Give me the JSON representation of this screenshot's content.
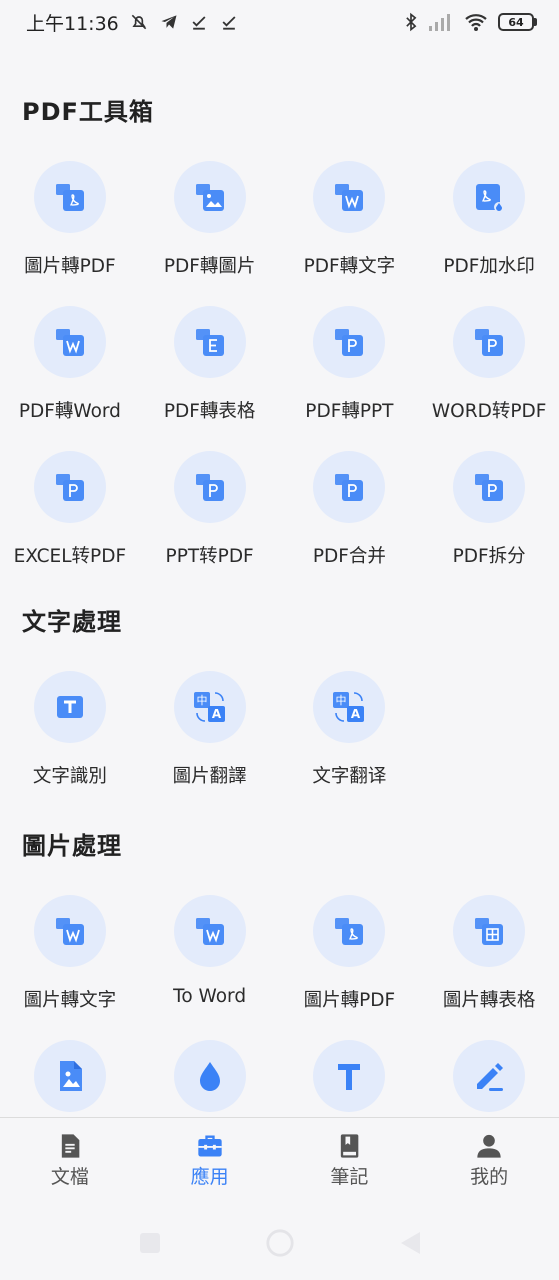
{
  "status_bar": {
    "time": "上午11:36",
    "battery": "64"
  },
  "sections": {
    "pdf": {
      "title": "PDF工具箱",
      "items": [
        {
          "label": "圖片轉PDF",
          "icon": "image-to-pdf-icon"
        },
        {
          "label": "PDF轉圖片",
          "icon": "pdf-to-image-icon"
        },
        {
          "label": "PDF轉文字",
          "icon": "pdf-to-text-icon"
        },
        {
          "label": "PDF加水印",
          "icon": "pdf-watermark-icon"
        },
        {
          "label": "PDF轉Word",
          "icon": "pdf-to-word-icon"
        },
        {
          "label": "PDF轉表格",
          "icon": "pdf-to-excel-icon"
        },
        {
          "label": "PDF轉PPT",
          "icon": "pdf-to-ppt-icon"
        },
        {
          "label": "WORD转PDF",
          "icon": "word-to-pdf-icon"
        },
        {
          "label": "EXCEL转PDF",
          "icon": "excel-to-pdf-icon"
        },
        {
          "label": "PPT转PDF",
          "icon": "ppt-to-pdf-icon"
        },
        {
          "label": "PDF合并",
          "icon": "pdf-merge-icon"
        },
        {
          "label": "PDF拆分",
          "icon": "pdf-split-icon"
        }
      ]
    },
    "text": {
      "title": "文字處理",
      "items": [
        {
          "label": "文字識別",
          "icon": "text-recognition-icon"
        },
        {
          "label": "圖片翻譯",
          "icon": "image-translate-icon"
        },
        {
          "label": "文字翻译",
          "icon": "text-translate-icon"
        }
      ]
    },
    "image": {
      "title": "圖片處理",
      "items": [
        {
          "label": "圖片轉文字",
          "icon": "image-to-text-icon"
        },
        {
          "label": "To Word",
          "icon": "image-to-word-icon"
        },
        {
          "label": "圖片轉PDF",
          "icon": "image-to-pdf-icon"
        },
        {
          "label": "圖片轉表格",
          "icon": "image-to-table-icon"
        },
        {
          "label": "",
          "icon": "image-file-icon"
        },
        {
          "label": "",
          "icon": "water-drop-icon"
        },
        {
          "label": "",
          "icon": "text-t-icon"
        },
        {
          "label": "",
          "icon": "edit-pen-icon"
        }
      ]
    }
  },
  "bottom_nav": {
    "items": [
      {
        "label": "文檔",
        "icon": "document-icon"
      },
      {
        "label": "應用",
        "icon": "toolbox-icon"
      },
      {
        "label": "筆記",
        "icon": "notebook-icon"
      },
      {
        "label": "我的",
        "icon": "person-icon"
      }
    ],
    "active": "應用"
  },
  "colors": {
    "accent": "#3b82f6",
    "icon_bg": "#e3ebfb",
    "background": "#f6f6f8"
  }
}
